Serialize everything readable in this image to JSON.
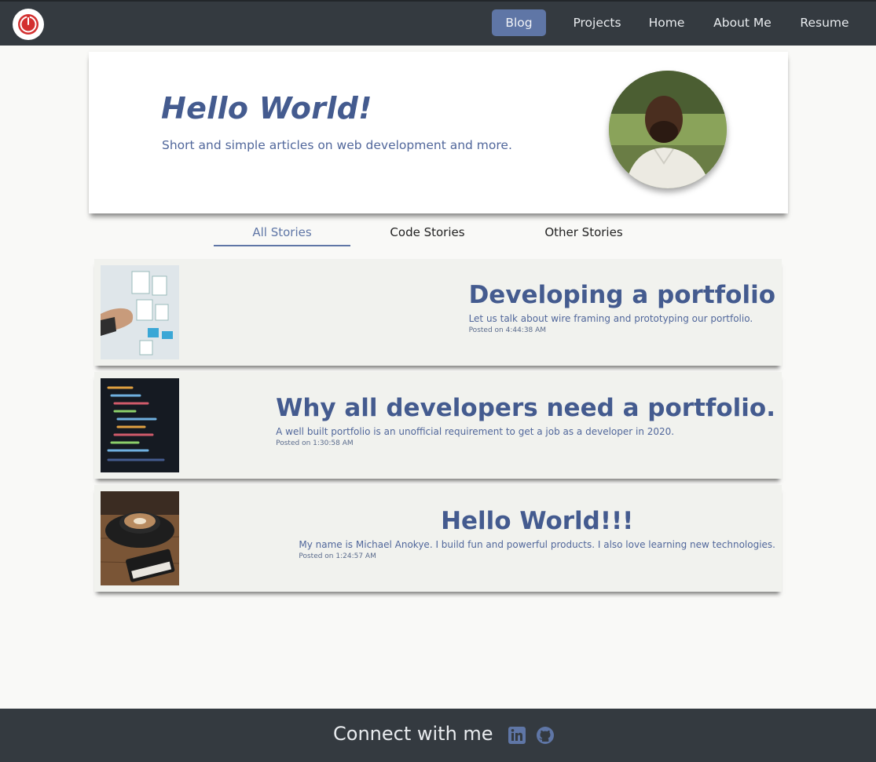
{
  "nav": {
    "logo_icon": "power-icon",
    "links": [
      {
        "label": "Blog",
        "active": true
      },
      {
        "label": "Projects"
      },
      {
        "label": "Home"
      },
      {
        "label": "About Me"
      },
      {
        "label": "Resume"
      }
    ]
  },
  "hero": {
    "title": "Hello World!",
    "subtitle": "Short and simple articles on web development and more."
  },
  "tabs": [
    {
      "label": "All Stories",
      "active": true
    },
    {
      "label": "Code Stories"
    },
    {
      "label": "Other Stories"
    }
  ],
  "posts": [
    {
      "title": "Developing a portfolio",
      "description": "Let us talk about wire framing and prototyping our portfolio.",
      "date": "Posted on 4:44:38 AM"
    },
    {
      "title": "Why all developers need a portfolio.",
      "description": "A well built portfolio is an unofficial requirement to get a job as a developer in 2020.",
      "date": "Posted on 1:30:58 AM"
    },
    {
      "title": "Hello World!!!",
      "description": "My name is Michael Anokye. I build fun and powerful products. I also love learning new technologies.",
      "date": "Posted on 1:24:57 AM"
    }
  ],
  "footer": {
    "text": "Connect with me",
    "icons": [
      "linkedin-icon",
      "github-icon"
    ]
  },
  "colors": {
    "navbar": "#343a40",
    "accent": "#5f76a6",
    "heading": "#445b8f",
    "card": "#f1f2ee",
    "logo_red": "#d32f2f"
  }
}
